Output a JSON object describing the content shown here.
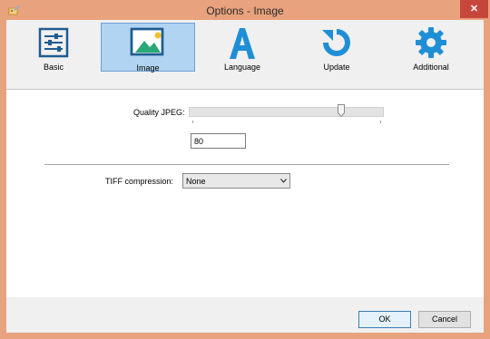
{
  "window": {
    "title": "Options - Image",
    "close_glyph": "✕"
  },
  "toolbar": {
    "items": [
      {
        "label": "Basic",
        "icon": "sliders-icon",
        "active": false
      },
      {
        "label": "Image",
        "icon": "image-icon",
        "active": true
      },
      {
        "label": "Language",
        "icon": "letter-a-icon",
        "active": false
      },
      {
        "label": "Update",
        "icon": "refresh-icon",
        "active": false
      },
      {
        "label": "Additional",
        "icon": "gear-icon",
        "active": false
      }
    ]
  },
  "image": {
    "quality_label": "Quality JPEG:",
    "quality_value": "80",
    "slider_level": 0.8,
    "tiff_label": "TIFF compression:",
    "tiff_value": "None"
  },
  "buttons": {
    "ok": "OK",
    "cancel": "Cancel"
  },
  "colors": {
    "titlebar": "#e8a27d",
    "accent": "#1e8fd6",
    "selected": "#b0d4f1",
    "close": "#c7463c"
  }
}
